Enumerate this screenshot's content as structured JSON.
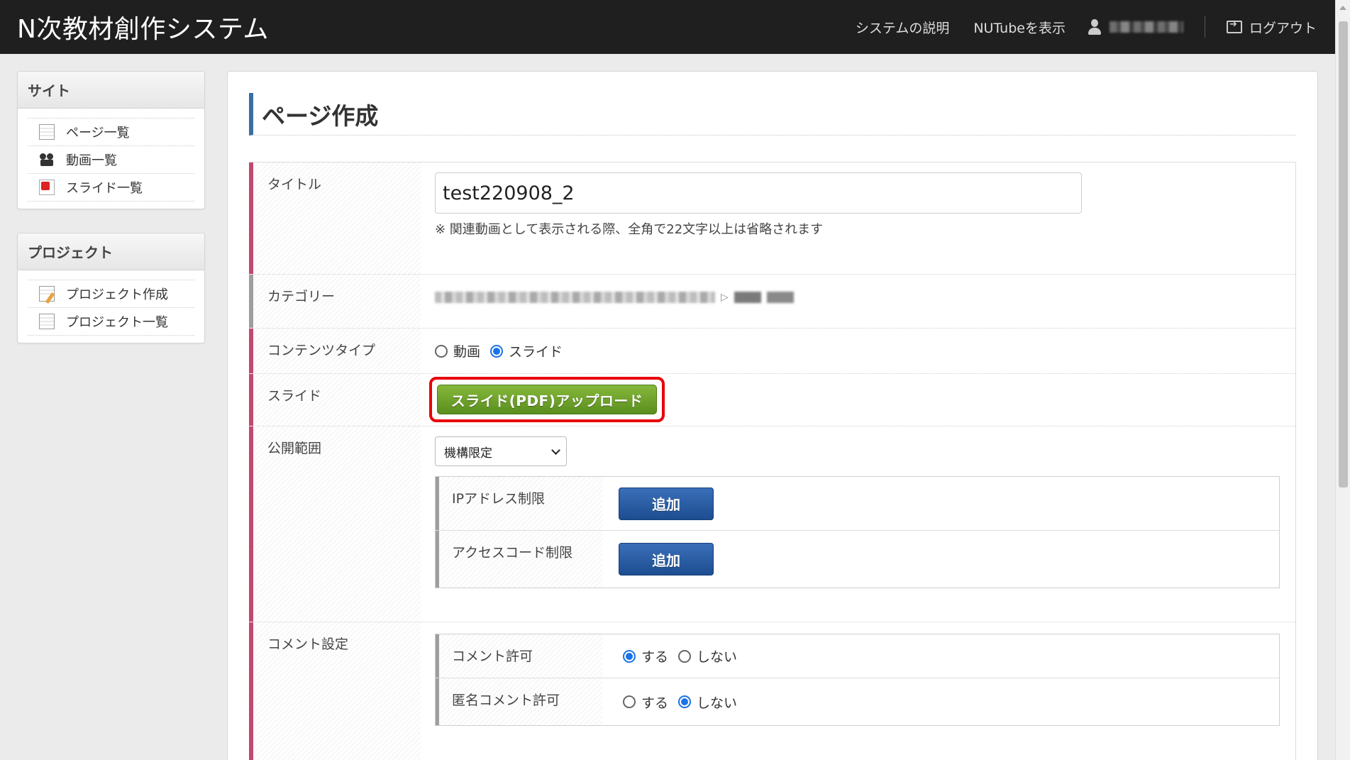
{
  "header": {
    "brand": "N次教材創作システム",
    "nav_about": "システムの説明",
    "nav_nutube": "NUTubeを表示",
    "logout": "ログアウト"
  },
  "sidebar": {
    "site": {
      "title": "サイト",
      "items": [
        {
          "label": "ページ一覧",
          "icon": "document-icon"
        },
        {
          "label": "動画一覧",
          "icon": "film-camera-icon"
        },
        {
          "label": "スライド一覧",
          "icon": "pdf-icon"
        }
      ]
    },
    "project": {
      "title": "プロジェクト",
      "items": [
        {
          "label": "プロジェクト作成",
          "icon": "document-edit-icon"
        },
        {
          "label": "プロジェクト一覧",
          "icon": "document-icon"
        }
      ]
    }
  },
  "main": {
    "page_title": "ページ作成",
    "title_row": {
      "label": "タイトル",
      "value": "test220908_2",
      "hint": "※ 関連動画として表示される際、全角で22文字以上は省略されます"
    },
    "category_row": {
      "label": "カテゴリー"
    },
    "content_type_row": {
      "label": "コンテンツタイプ",
      "option_video": "動画",
      "option_slide": "スライド",
      "selected": "スライド"
    },
    "slide_row": {
      "label": "スライド",
      "upload_button": "スライド(PDF)アップロード"
    },
    "visibility_row": {
      "label": "公開範囲",
      "selected": "機構限定",
      "ip_label": "IPアドレス制限",
      "ip_add": "追加",
      "access_label": "アクセスコード制限",
      "access_add": "追加"
    },
    "comment_row": {
      "label": "コメント設定",
      "allow_label": "コメント許可",
      "allow_yes": "する",
      "allow_no": "しない",
      "allow_selected": "する",
      "anon_label": "匿名コメント許可",
      "anon_yes": "する",
      "anon_no": "しない",
      "anon_selected": "しない"
    }
  },
  "colors": {
    "header_bg": "#1f1f1f",
    "row_accent": "#c2496e",
    "upload_green": "#6aa02a",
    "add_blue": "#2a5da3",
    "highlight_red": "#e8000b",
    "radio_blue": "#1a73e8"
  }
}
